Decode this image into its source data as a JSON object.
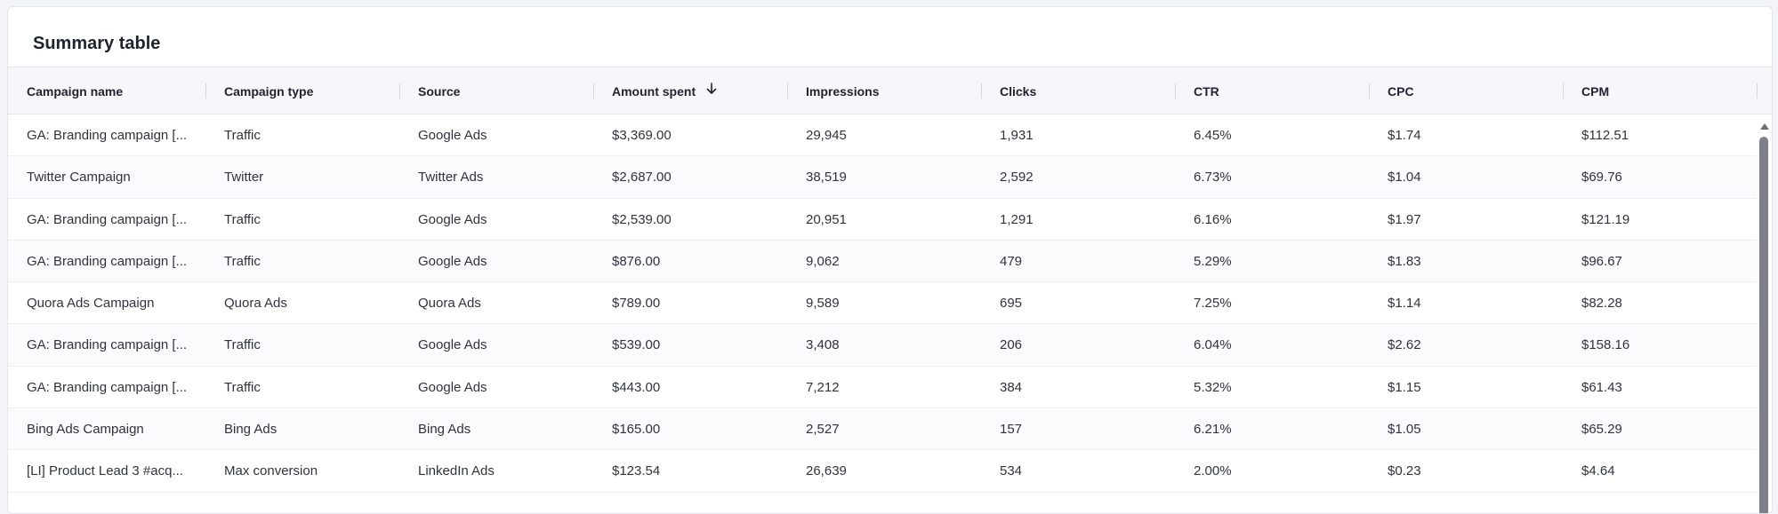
{
  "title": "Summary table",
  "columns": [
    "Campaign name",
    "Campaign type",
    "Source",
    "Amount spent",
    "Impressions",
    "Clicks",
    "CTR",
    "CPC",
    "CPM"
  ],
  "rows": [
    [
      "GA: Branding campaign [...",
      "Traffic",
      "Google Ads",
      "$3,369.00",
      "29,945",
      "1,931",
      "6.45%",
      "$1.74",
      "$112.51"
    ],
    [
      "Twitter Campaign",
      "Twitter",
      "Twitter Ads",
      "$2,687.00",
      "38,519",
      "2,592",
      "6.73%",
      "$1.04",
      "$69.76"
    ],
    [
      "GA: Branding campaign [...",
      "Traffic",
      "Google Ads",
      "$2,539.00",
      "20,951",
      "1,291",
      "6.16%",
      "$1.97",
      "$121.19"
    ],
    [
      "GA: Branding campaign [...",
      "Traffic",
      "Google Ads",
      "$876.00",
      "9,062",
      "479",
      "5.29%",
      "$1.83",
      "$96.67"
    ],
    [
      "Quora Ads Campaign",
      "Quora Ads",
      "Quora Ads",
      "$789.00",
      "9,589",
      "695",
      "7.25%",
      "$1.14",
      "$82.28"
    ],
    [
      "GA: Branding campaign [...",
      "Traffic",
      "Google Ads",
      "$539.00",
      "3,408",
      "206",
      "6.04%",
      "$2.62",
      "$158.16"
    ],
    [
      "GA: Branding campaign [...",
      "Traffic",
      "Google Ads",
      "$443.00",
      "7,212",
      "384",
      "5.32%",
      "$1.15",
      "$61.43"
    ],
    [
      "Bing Ads Campaign",
      "Bing Ads",
      "Bing Ads",
      "$165.00",
      "2,527",
      "157",
      "6.21%",
      "$1.05",
      "$65.29"
    ],
    [
      "[LI] Product Lead 3 #acq...",
      "Max conversion",
      "LinkedIn Ads",
      "$123.54",
      "26,639",
      "534",
      "2.00%",
      "$0.23",
      "$4.64"
    ]
  ],
  "sort": {
    "column": "Amount spent",
    "direction": "descending",
    "icon": "arrow-down-icon"
  }
}
